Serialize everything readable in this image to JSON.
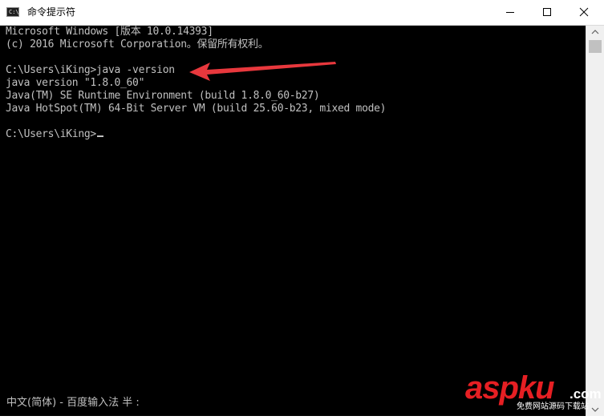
{
  "window": {
    "title": "命令提示符",
    "icon_label": "C:\\"
  },
  "console": {
    "lines": [
      "Microsoft Windows [版本 10.0.14393]",
      "(c) 2016 Microsoft Corporation。保留所有权利。",
      "",
      "C:\\Users\\iKing>java -version",
      "java version \"1.8.0_60\"",
      "Java(TM) SE Runtime Environment (build 1.8.0_60-b27)",
      "Java HotSpot(TM) 64-Bit Server VM (build 25.60-b23, mixed mode)",
      "",
      "C:\\Users\\iKing>"
    ],
    "ime_status": "中文(简体) - 百度输入法 半 :"
  },
  "annotation": {
    "arrow_color": "#e8383d"
  },
  "watermark": {
    "brand": "aspku",
    "suffix": ".com",
    "tagline": "免费网站源码下载站"
  },
  "colors": {
    "console_bg": "#000000",
    "console_text": "#c0c0c0",
    "watermark_red": "#e61f23"
  }
}
